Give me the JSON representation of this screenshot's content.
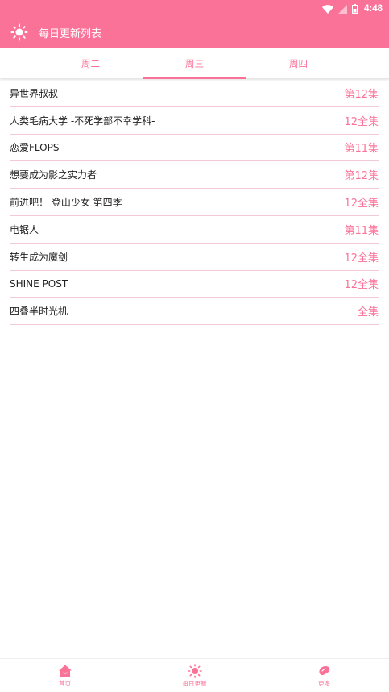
{
  "status_bar": {
    "time": "4:48"
  },
  "toolbar": {
    "title": "每日更新列表",
    "icon": "sun-icon"
  },
  "tabs": [
    {
      "label": "周二",
      "active": false
    },
    {
      "label": "周三",
      "active": true
    },
    {
      "label": "周四",
      "active": false
    }
  ],
  "list": [
    {
      "name": "异世界叔叔",
      "episode": "第12集"
    },
    {
      "name": "人类毛病大学 -不死学部不幸学科-",
      "episode": "12全集"
    },
    {
      "name": "恋爱FLOPS",
      "episode": "第11集"
    },
    {
      "name": "想要成为影之实力者",
      "episode": "第12集"
    },
    {
      "name": "前进吧！ 登山少女 第四季",
      "episode": "12全集"
    },
    {
      "name": "电锯人",
      "episode": "第11集"
    },
    {
      "name": "转生成为魔剑",
      "episode": "12全集"
    },
    {
      "name": "SHINE POST",
      "episode": "12全集"
    },
    {
      "name": "四叠半时光机",
      "episode": "全集"
    }
  ],
  "bottom_nav": [
    {
      "label": "首页",
      "icon": "home-icon"
    },
    {
      "label": "每日更新",
      "icon": "sun-icon"
    },
    {
      "label": "更多",
      "icon": "more-bean-icon"
    }
  ],
  "colors": {
    "accent": "#fb7299",
    "divider": "#f4c9d6",
    "text": "#222222"
  }
}
